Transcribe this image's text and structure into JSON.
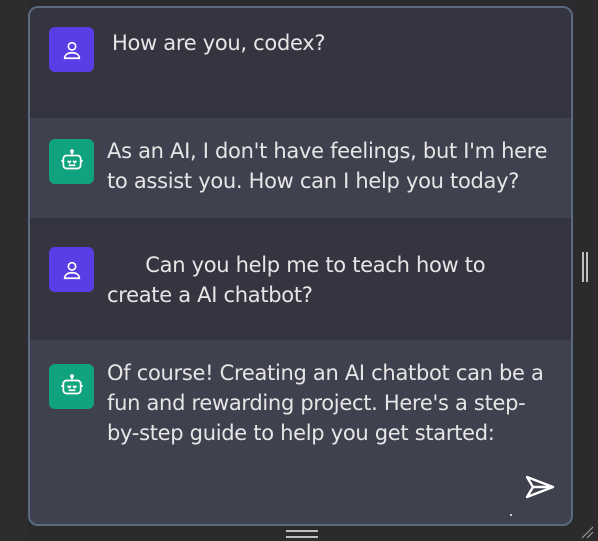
{
  "messages": [
    {
      "role": "user",
      "avatar_icon": "user-icon",
      "text": "How are you, codex?"
    },
    {
      "role": "ai",
      "avatar_icon": "robot-icon",
      "text": "As an AI, I don't have feelings, but I'm here to assist you. How can I help you today?"
    },
    {
      "role": "user",
      "avatar_icon": "user-icon",
      "text": "      Can you help me to teach how to create a AI chatbot?"
    },
    {
      "role": "ai",
      "avatar_icon": "robot-icon",
      "text": "Of course! Creating an AI chatbot can be a fun and rewarding project. Here's a step-by-step guide to help you get started:"
    }
  ],
  "colors": {
    "user_avatar": "#5b3de5",
    "ai_avatar": "#10a37f",
    "user_bg": "#343541",
    "ai_bg": "#40414f"
  },
  "send_icon": "send-icon"
}
